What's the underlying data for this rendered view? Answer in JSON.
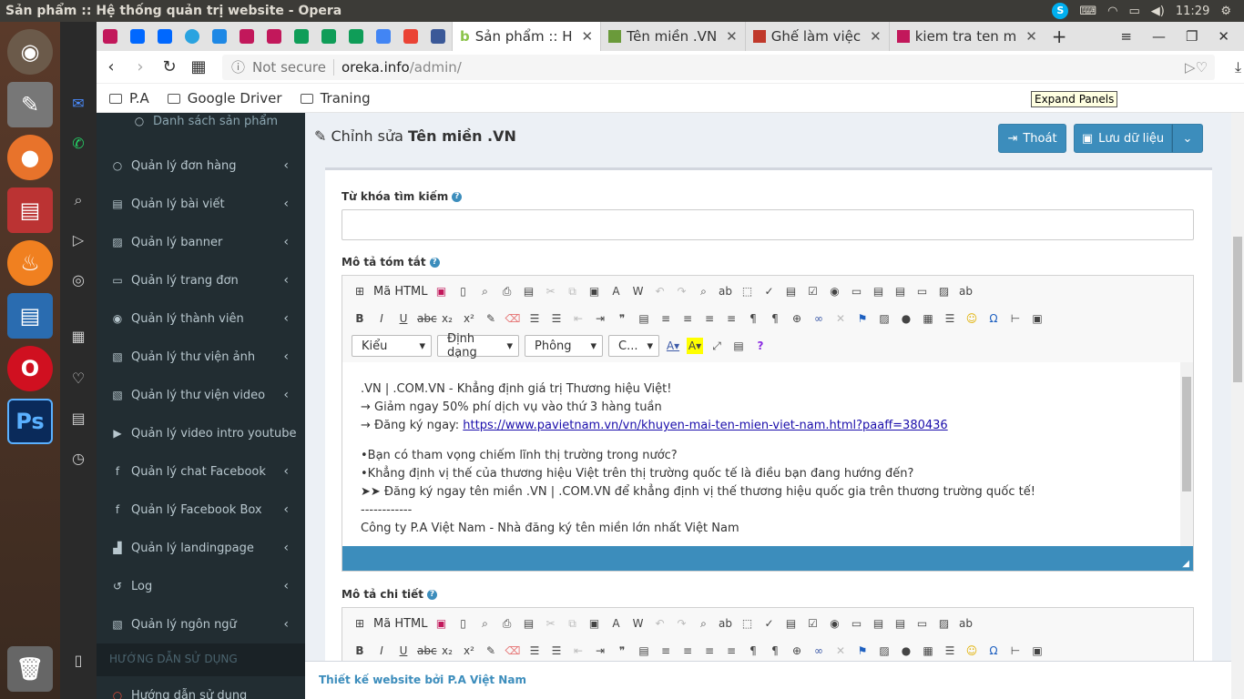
{
  "os": {
    "window_title": "Sản phẩm :: Hệ thống quản trị website - Opera",
    "clock": "11:29"
  },
  "tabs": {
    "active_label": "Sản phẩm :: H",
    "tab2_label": "Tên miền .VN",
    "tab3_label": "Ghế làm việc",
    "tab4_label": "kiem tra ten m"
  },
  "address": {
    "security": "Not secure",
    "host": "oreka.info",
    "path": "/admin/"
  },
  "bookmarks": [
    "P.A",
    "Google Driver",
    "Traning"
  ],
  "tooltip": "Expand Panels",
  "sidebar": {
    "sub_item": "Danh sách sản phẩm",
    "items": [
      "Quản lý đơn hàng",
      "Quản lý bài viết",
      "Quản lý banner",
      "Quản lý trang đơn",
      "Quản lý thành viên",
      "Quản lý thư viện ảnh",
      "Quản lý thư viện video",
      "Quản lý video intro youtube",
      "Quản lý chat Facebook",
      "Quản lý Facebook Box",
      "Quản lý landingpage",
      "Log",
      "Quản lý ngôn ngữ"
    ],
    "section_header": "HƯỚNG DẪN SỬ DỤNG",
    "guide_item": "Hướng dẫn sử dụng"
  },
  "page": {
    "title_prefix": "Chỉnh sửa",
    "title_name": "Tên miền .VN",
    "exit_label": "Thoát",
    "save_label": "Lưu dữ liệu"
  },
  "form": {
    "keyword_label": "Từ khóa tìm kiếm",
    "keyword_value": "",
    "summary_label": "Mô tả tóm tắt",
    "detail_label": "Mô tả chi tiết",
    "source_label": "Mã HTML",
    "combo_style": "Kiểu",
    "combo_format": "Định dạng",
    "combo_font": "Phông",
    "combo_size": "C..."
  },
  "summary_lines": {
    "l1": ".VN | .COM.VN - Khẳng định giá trị Thương hiệu Việt!",
    "l2": "→ Giảm ngay 50% phí dịch vụ vào thứ 3 hàng tuần",
    "l3_prefix": "→ Đăng ký ngay: ",
    "l3_link": "https://www.pavietnam.vn/vn/khuyen-mai-ten-mien-viet-nam.html?paaff=380436",
    "l4": "•Bạn có tham vọng chiếm lĩnh thị trường trong nước?",
    "l5": "•Khẳng định vị thế của thương hiệu Việt trên thị trường quốc tế là điều bạn đang hướng đến?",
    "l6": "➤➤ Đăng ký ngay tên miền .VN | .COM.VN để khẳng định vị thế thương hiệu quốc gia trên thương trường quốc tế!",
    "l7": "------------",
    "l8": "Công ty P.A Việt Nam - Nhà đăng ký tên miền lớn nhất Việt Nam"
  },
  "footer": "Thiết kế website bởi P.A Việt Nam"
}
